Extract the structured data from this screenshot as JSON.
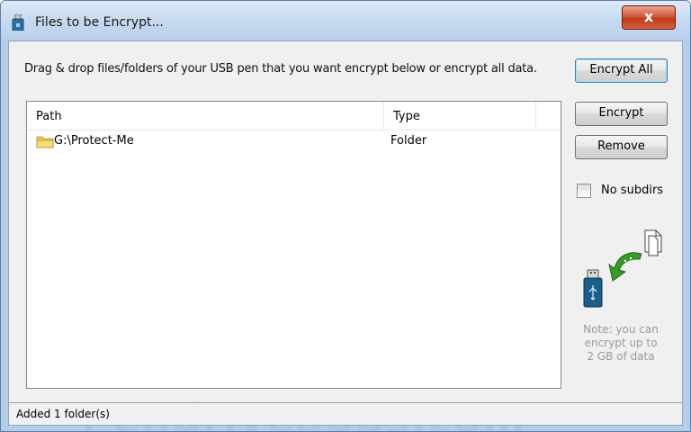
{
  "window": {
    "title": "Files to be Encrypt...",
    "close_label": "x"
  },
  "instruction": "Drag & drop files/folders of your USB pen that you want encrypt below or encrypt all data.",
  "buttons": {
    "encrypt_all": "Encrypt All",
    "encrypt": "Encrypt",
    "remove": "Remove"
  },
  "list": {
    "columns": [
      "Path",
      "Type"
    ],
    "rows": [
      {
        "path": "G:\\Protect-Me",
        "type": "Folder",
        "icon": "folder-icon"
      }
    ]
  },
  "options": {
    "no_subdirs_label": "No subdirs",
    "no_subdirs_checked": false
  },
  "note": {
    "line1": "Note: you can",
    "line2": "encrypt up to",
    "line3": "2 GB of data"
  },
  "watermark": "Pendriveapps.com",
  "status": "Added 1 folder(s)",
  "colors": {
    "title_gradient": "#c6d9ef",
    "close_button": "#c03a1a",
    "arrow_green": "#3a9a2a",
    "usb_blue": "#1a5e8a"
  }
}
